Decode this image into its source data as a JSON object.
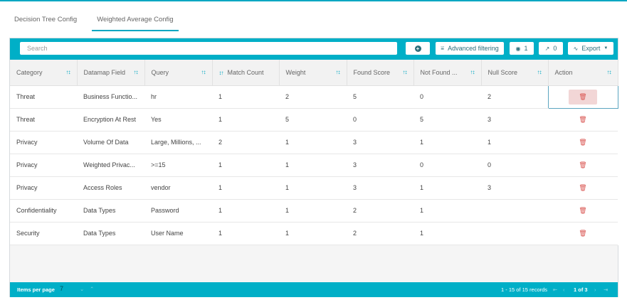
{
  "tabs": [
    {
      "label": "Decision Tree Config",
      "active": false
    },
    {
      "label": "Weighted Average Config",
      "active": true
    }
  ],
  "toolbar": {
    "search_placeholder": "Search",
    "add_icon": "plus-circle-icon",
    "advanced_filtering_label": "Advanced filtering",
    "visible_count": "1",
    "pinned_count": "0",
    "export_label": "Export"
  },
  "table": {
    "columns": [
      "Category",
      "Datamap Field",
      "Query",
      "Match Count",
      "Weight",
      "Found Score",
      "Not Found ...",
      "Null Score",
      "Action"
    ],
    "rows": [
      {
        "category": "Threat",
        "field": "Business Functio...",
        "query": "hr",
        "match": "1",
        "weight": "2",
        "found": "5",
        "notfound": "0",
        "null": "2"
      },
      {
        "category": "Threat",
        "field": "Encryption At Rest",
        "query": "Yes",
        "match": "1",
        "weight": "5",
        "found": "0",
        "notfound": "5",
        "null": "3"
      },
      {
        "category": "Privacy",
        "field": "Volume Of Data",
        "query": "Large, Millions, ...",
        "match": "2",
        "weight": "1",
        "found": "3",
        "notfound": "1",
        "null": "1"
      },
      {
        "category": "Privacy",
        "field": "Weighted Privac...",
        "query": ">=15",
        "match": "1",
        "weight": "1",
        "found": "3",
        "notfound": "0",
        "null": "0"
      },
      {
        "category": "Privacy",
        "field": "Access Roles",
        "query": "vendor",
        "match": "1",
        "weight": "1",
        "found": "3",
        "notfound": "1",
        "null": "3"
      },
      {
        "category": "Confidentiality",
        "field": "Data Types",
        "query": "Password",
        "match": "1",
        "weight": "1",
        "found": "2",
        "notfound": "1",
        "null": ""
      },
      {
        "category": "Security",
        "field": "Data Types",
        "query": "User Name",
        "match": "1",
        "weight": "1",
        "found": "2",
        "notfound": "1",
        "null": ""
      }
    ]
  },
  "footer": {
    "items_per_page_label": "Items per page",
    "items_per_page_value": "7",
    "range_text": "1 - 15 of 15 records",
    "page_text": "1 of 3"
  },
  "colors": {
    "accent": "#00afc7",
    "delete": "#d9534f"
  }
}
